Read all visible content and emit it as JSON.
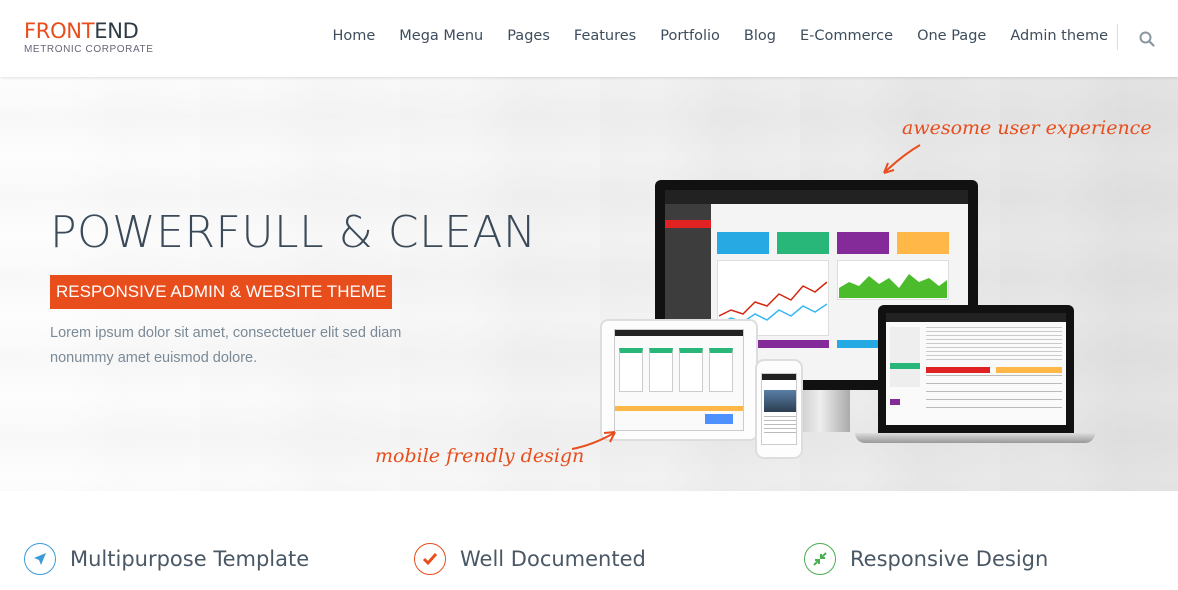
{
  "brand": {
    "logo_front": "FRONT",
    "logo_end": "END",
    "logo_sub": "METRONIC CORPORATE",
    "accent_color": "#e84d1c"
  },
  "nav": {
    "items": [
      "Home",
      "Mega Menu",
      "Pages",
      "Features",
      "Portfolio",
      "Blog",
      "E-Commerce",
      "One Page",
      "Admin theme"
    ],
    "search_icon": "search-icon"
  },
  "hero": {
    "title": "POWERFULL & CLEAN",
    "badge": "RESPONSIVE ADMIN & WEBSITE THEME",
    "text": "Lorem ipsum dolor sit amet, consectetuer elit sed diam nonummy amet euismod dolore.",
    "annotation_top": "awesome user experience",
    "annotation_bottom": "mobile frendly design"
  },
  "features": [
    {
      "label": "Multipurpose Template",
      "icon": "paper-plane-icon",
      "color": "#3b9bd8"
    },
    {
      "label": "Well Documented",
      "icon": "check-icon",
      "color": "#e84d1c"
    },
    {
      "label": "Responsive Design",
      "icon": "compress-icon",
      "color": "#4caf50"
    }
  ]
}
